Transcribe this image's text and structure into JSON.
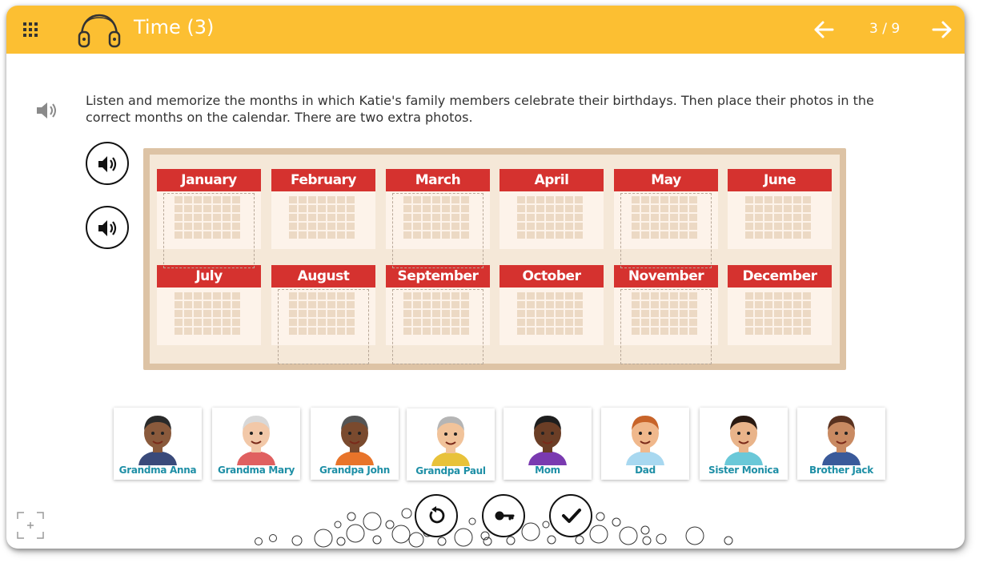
{
  "header": {
    "title": "Time (3)",
    "pager": "3 / 9",
    "color": "#fcbf32"
  },
  "icons": {
    "menu": "grid-menu-icon",
    "audio": "headphones-icon",
    "prev": "arrow-left-icon",
    "next": "arrow-right-icon",
    "speaker": "speaker-icon",
    "fullscreen": "fullscreen-icon"
  },
  "instruction": "Listen and memorize the months in which Katie's family members celebrate their birthdays. Then place their photos in the correct months on the calendar. There are two extra photos.",
  "calendar": {
    "months": [
      "January",
      "February",
      "March",
      "April",
      "May",
      "June",
      "July",
      "August",
      "September",
      "October",
      "November",
      "December"
    ],
    "month_color": "#d5322f"
  },
  "photos": [
    {
      "label": "Grandma Anna"
    },
    {
      "label": "Grandma Mary"
    },
    {
      "label": "Grandpa John"
    },
    {
      "label": "Grandpa Paul"
    },
    {
      "label": "Mom"
    },
    {
      "label": "Dad"
    },
    {
      "label": "Sister Monica"
    },
    {
      "label": "Brother Jack"
    }
  ],
  "actions": {
    "reset": "reset-icon",
    "key": "answer-key-icon",
    "check": "check-icon"
  }
}
